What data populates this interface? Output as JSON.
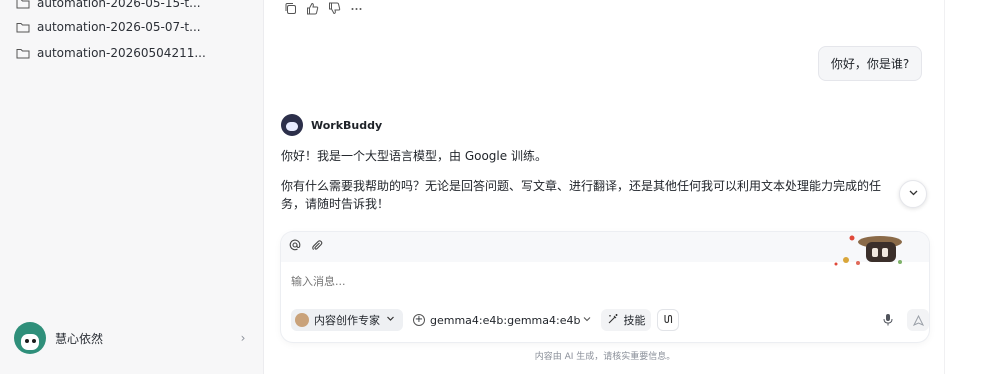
{
  "sidebar": {
    "items": [
      {
        "label": "automation-2026-05-15-t...",
        "icon": "folder-icon"
      },
      {
        "label": "automation-2026-05-07-t...",
        "icon": "folder-icon"
      },
      {
        "label": "automation-20260504211...",
        "icon": "folder-icon"
      }
    ],
    "user": {
      "name": "慧心依然",
      "chevron": "›"
    }
  },
  "chat": {
    "user_message": "你好，你是谁?",
    "bot_name": "WorkBuddy",
    "bot_paragraph_1": "你好！我是一个大型语言模型，由 Google 训练。",
    "bot_paragraph_2": "你有什么需要我帮助的吗？无论是回答问题、写文章、进行翻译，还是其他任何我可以利用文本处理能力完成的任务，请随时告诉我！"
  },
  "composer": {
    "placeholder": "输入消息...",
    "agent_label": "内容创作专家",
    "model_label": "gemma4:e4b:gemma4:e4b",
    "skill_label": "技能"
  },
  "footer": {
    "disclaimer": "内容由 AI 生成，请核实重要信息。"
  }
}
